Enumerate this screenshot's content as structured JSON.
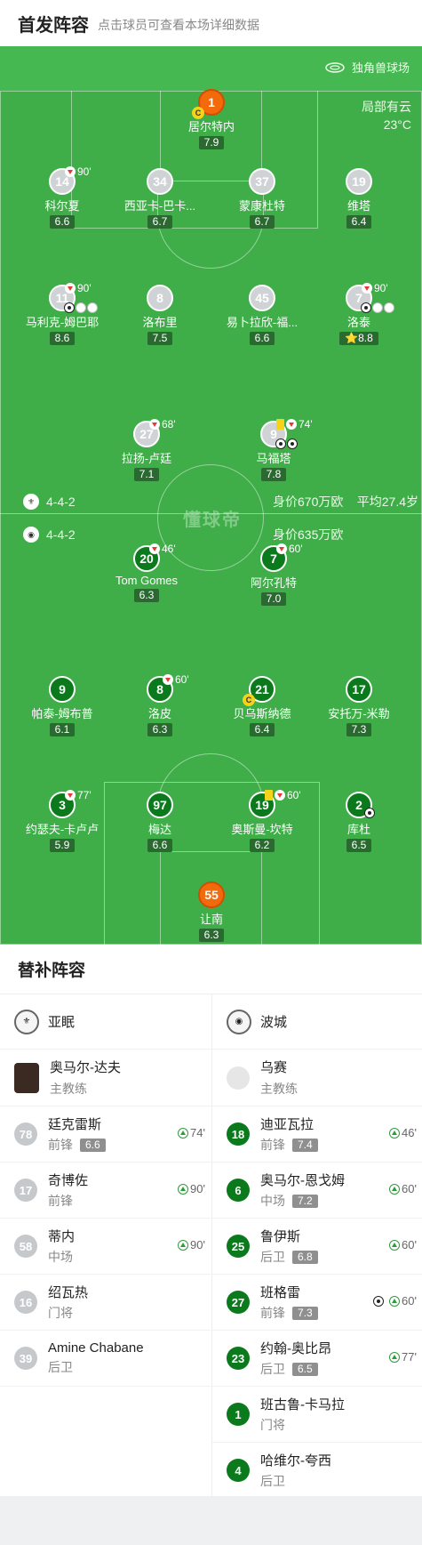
{
  "header": {
    "title": "首发阵容",
    "subtitle": "点击球员可查看本场详细数据"
  },
  "stadium": {
    "name": "独角兽球场",
    "icon": "stadium-icon"
  },
  "weather": {
    "condition": "局部有云",
    "temp": "23°C"
  },
  "home": {
    "formation": "4-4-2",
    "value": "身价670万欧",
    "avg_age": "平均27.4岁",
    "players": [
      {
        "num": "1",
        "name": "居尔特内",
        "rating": "7.9",
        "gk": true,
        "captain": true
      },
      {
        "num": "14",
        "name": "科尔夏",
        "rating": "6.6",
        "sub_min": "90'"
      },
      {
        "num": "34",
        "name": "西亚卡-巴卡...",
        "rating": "6.7"
      },
      {
        "num": "37",
        "name": "蒙康杜特",
        "rating": "6.7"
      },
      {
        "num": "19",
        "name": "维塔",
        "rating": "6.4"
      },
      {
        "num": "11",
        "name": "马利克-姆巴耶",
        "rating": "8.6",
        "sub_min": "90'"
      },
      {
        "num": "8",
        "name": "洛布里",
        "rating": "7.5"
      },
      {
        "num": "45",
        "name": "易卜拉欣-福...",
        "rating": "6.6"
      },
      {
        "num": "7",
        "name": "洛泰",
        "rating": "8.8",
        "sub_min": "90'",
        "star": "⭐"
      },
      {
        "num": "27",
        "name": "拉扬-卢廷",
        "rating": "7.1",
        "sub_min": "68'"
      },
      {
        "num": "9",
        "name": "马福塔",
        "rating": "7.8",
        "sub_min": "74'"
      }
    ]
  },
  "away": {
    "formation": "4-4-2",
    "value": "身价635万欧",
    "players": [
      {
        "num": "20",
        "name": "Tom Gomes",
        "rating": "6.3",
        "sub_min": "46'"
      },
      {
        "num": "7",
        "name": "阿尔孔特",
        "rating": "7.0",
        "sub_min": "60'"
      },
      {
        "num": "9",
        "name": "帕泰-姆布普",
        "rating": "6.1"
      },
      {
        "num": "8",
        "name": "洛皮",
        "rating": "6.3",
        "sub_min": "60'"
      },
      {
        "num": "21",
        "name": "贝乌斯纳德",
        "rating": "6.4",
        "captain": true
      },
      {
        "num": "17",
        "name": "安托万-米勒",
        "rating": "7.3"
      },
      {
        "num": "3",
        "name": "约瑟夫-卡卢卢",
        "rating": "5.9",
        "sub_min": "77'"
      },
      {
        "num": "97",
        "name": "梅达",
        "rating": "6.6"
      },
      {
        "num": "19",
        "name": "奥斯曼-坎特",
        "rating": "6.2",
        "sub_min": "60'"
      },
      {
        "num": "2",
        "name": "库杜",
        "rating": "6.5"
      },
      {
        "num": "55",
        "name": "让南",
        "rating": "6.3",
        "gk": true
      }
    ]
  },
  "captain_mark": "C",
  "watermark": "懂球帝",
  "bench": {
    "title": "替补阵容",
    "home": {
      "team": "亚眠",
      "coach": {
        "name": "奥马尔-达夫",
        "role": "主教练"
      },
      "subs": [
        {
          "num": "78",
          "name": "廷克雷斯",
          "pos": "前锋",
          "rating": "6.6",
          "in": "74'"
        },
        {
          "num": "17",
          "name": "奇博佐",
          "pos": "前锋",
          "in": "90'"
        },
        {
          "num": "58",
          "name": "蒂内",
          "pos": "中场",
          "in": "90'"
        },
        {
          "num": "16",
          "name": "绍瓦热",
          "pos": "门将"
        },
        {
          "num": "39",
          "name": "Amine Chabane",
          "pos": "后卫"
        }
      ]
    },
    "away": {
      "team": "波城",
      "coach": {
        "name": "乌赛",
        "role": "主教练"
      },
      "subs": [
        {
          "num": "18",
          "name": "迪亚瓦拉",
          "pos": "前锋",
          "rating": "7.4",
          "in": "46'"
        },
        {
          "num": "6",
          "name": "奥马尔-恩戈姆",
          "pos": "中场",
          "rating": "7.2",
          "in": "60'"
        },
        {
          "num": "25",
          "name": "鲁伊斯",
          "pos": "后卫",
          "rating": "6.8",
          "in": "60'"
        },
        {
          "num": "27",
          "name": "班格雷",
          "pos": "前锋",
          "rating": "7.3",
          "in": "60'",
          "goal": true
        },
        {
          "num": "23",
          "name": "约翰-奥比昂",
          "pos": "后卫",
          "rating": "6.5",
          "in": "77'"
        },
        {
          "num": "1",
          "name": "班古鲁-卡马拉",
          "pos": "门将"
        },
        {
          "num": "4",
          "name": "哈维尔-夸西",
          "pos": "后卫"
        }
      ]
    }
  }
}
